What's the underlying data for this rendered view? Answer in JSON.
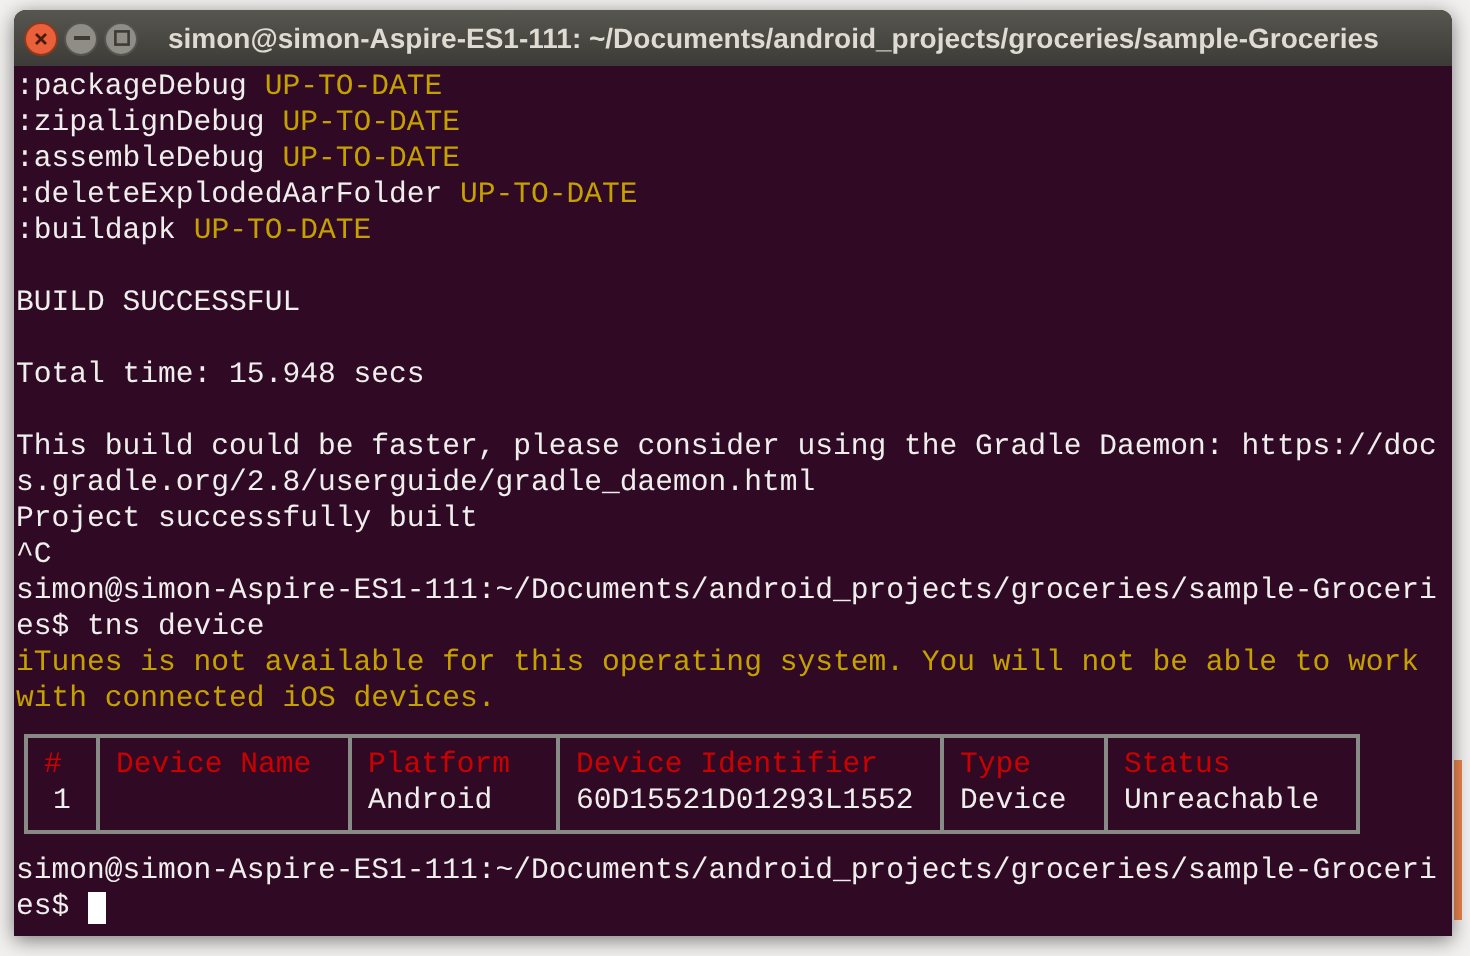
{
  "window": {
    "title": "simon@simon-Aspire-ES1-111: ~/Documents/android_projects/groceries/sample-Groceries"
  },
  "output": [
    {
      "kind": "task",
      "text": ":packageDebug",
      "status": "UP-TO-DATE"
    },
    {
      "kind": "task",
      "text": ":zipalignDebug",
      "status": "UP-TO-DATE"
    },
    {
      "kind": "task",
      "text": ":assembleDebug",
      "status": "UP-TO-DATE"
    },
    {
      "kind": "task",
      "text": ":deleteExplodedAarFolder",
      "status": "UP-TO-DATE"
    },
    {
      "kind": "task",
      "text": ":buildapk",
      "status": "UP-TO-DATE"
    },
    {
      "kind": "blank"
    },
    {
      "kind": "plain",
      "text": "BUILD SUCCESSFUL"
    },
    {
      "kind": "blank"
    },
    {
      "kind": "plain",
      "text": "Total time: 15.948 secs"
    },
    {
      "kind": "blank"
    },
    {
      "kind": "plain",
      "text": "This build could be faster, please consider using the Gradle Daemon: https://doc"
    },
    {
      "kind": "plain",
      "text": "s.gradle.org/2.8/userguide/gradle_daemon.html"
    },
    {
      "kind": "plain",
      "text": "Project successfully built"
    },
    {
      "kind": "plain",
      "text": "^C"
    },
    {
      "kind": "plain",
      "text": "simon@simon-Aspire-ES1-111:~/Documents/android_projects/groceries/sample-Groceri"
    },
    {
      "kind": "plain",
      "text": "es$ tns device"
    },
    {
      "kind": "warning",
      "text": "iTunes is not available for this operating system. You will not be able to work"
    },
    {
      "kind": "warning",
      "text": "with connected iOS devices."
    }
  ],
  "device_table": {
    "columns": [
      "#",
      "Device Name",
      "Platform",
      "Device Identifier",
      "Type",
      "Status"
    ],
    "rows": [
      [
        "1",
        "",
        "Android",
        "60D15521D01293L1552",
        "Device",
        "Unreachable"
      ]
    ]
  },
  "prompt": [
    {
      "kind": "plain",
      "text": "simon@simon-Aspire-ES1-111:~/Documents/android_projects/groceries/sample-Groceri"
    },
    {
      "kind": "cursor",
      "text": "es$"
    }
  ]
}
